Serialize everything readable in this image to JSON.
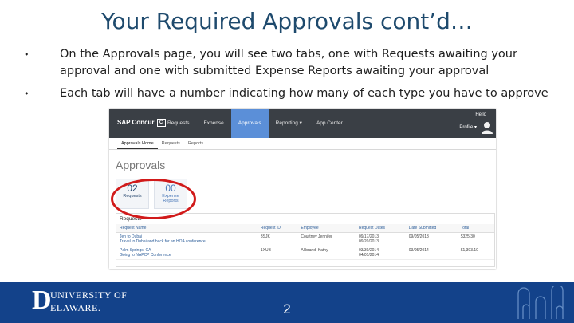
{
  "slide": {
    "title": "Your Required Approvals cont’d…",
    "bullets": [
      "On the Approvals page, you will see two tabs, one with Requests awaiting your approval and one with submitted Expense Reports awaiting your approval",
      "Each tab will have a number indicating how many of each type you have to approve"
    ],
    "bullet_glyph": "•",
    "page_number": "2"
  },
  "app": {
    "brand": "SAP Concur",
    "brand_mark": "C",
    "nav": [
      "Requests",
      "Expense",
      "Approvals",
      "Reporting ▾",
      "App Center"
    ],
    "nav_active": "Approvals",
    "greeting": "Hello",
    "profile_label": "Profile ▾",
    "subnav": [
      "Approvals Home",
      "Requests",
      "Reports"
    ],
    "subnav_active": "Approvals Home",
    "page_heading": "Approvals",
    "tiles": [
      {
        "count": "02",
        "label": "Requests"
      },
      {
        "count": "00",
        "label": "Expense Reports"
      }
    ],
    "highlight_color": "#d11a1a",
    "requests": {
      "title": "Requests",
      "columns": [
        "Request Name",
        "Request ID",
        "Employee",
        "Request Dates",
        "Date Submitted",
        "Total"
      ],
      "rows": [
        [
          "Jen to Dubai\nTravel to Dubai and back for an HOA conference",
          "3SJK",
          "Courtney Jennifer",
          "09/17/2013\n09/20/2013",
          "09/05/2013",
          "$325.30"
        ],
        [
          "Palm Springs, CA\nGoing to NAPCP Conference",
          "1XUB",
          "Akbrand, Kathy",
          "03/30/2014\n04/01/2014",
          "03/05/2014",
          "$1,393.10"
        ]
      ]
    }
  },
  "footer": {
    "logo_initial": "D",
    "logo_top": "UNIVERSITY OF",
    "logo_bottom": "ELAWARE.",
    "bg_color": "#13428a"
  }
}
